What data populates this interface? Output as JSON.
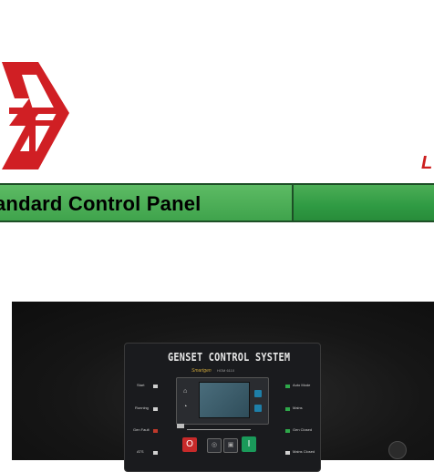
{
  "banner": {
    "title": "andard Control Panel"
  },
  "corner_mark": {
    "text": "L",
    "color": "#cc1f1f"
  },
  "logo": {
    "description_icon": "company-logo",
    "color": "#d01f24"
  },
  "photo": {
    "panel_title": "GENSET CONTROL SYSTEM",
    "brand": "Smartgen",
    "model": "HGM 6110",
    "left_labels": [
      "Start",
      "Running",
      "Gen Fault",
      "ATS"
    ],
    "right_labels": [
      "Auto Mode",
      "Mains",
      "Gen Closed",
      "Mains Closed"
    ],
    "buttons": {
      "stop": "O",
      "start": "I"
    }
  }
}
